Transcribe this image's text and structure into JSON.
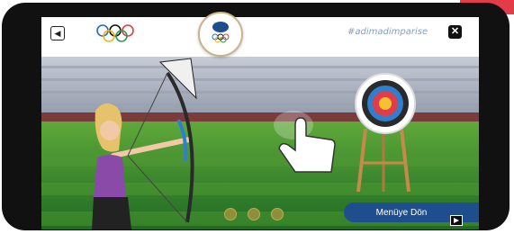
{
  "game": {
    "hashtag": "#adimadimparise",
    "menu_button_label": "Menüye Dön",
    "arrows_remaining": 3
  },
  "icons": {
    "sound": "speaker-icon",
    "olympic": "olympic-rings-icon",
    "close": "close-icon",
    "hand": "hand-pointer-icon",
    "play": "play-icon"
  },
  "colors": {
    "brand_red": "#e23b4a",
    "menu_blue": "#1f4e8e",
    "hashtag_blue": "#7ea1c8",
    "grass_green": "#2f7a2b"
  }
}
